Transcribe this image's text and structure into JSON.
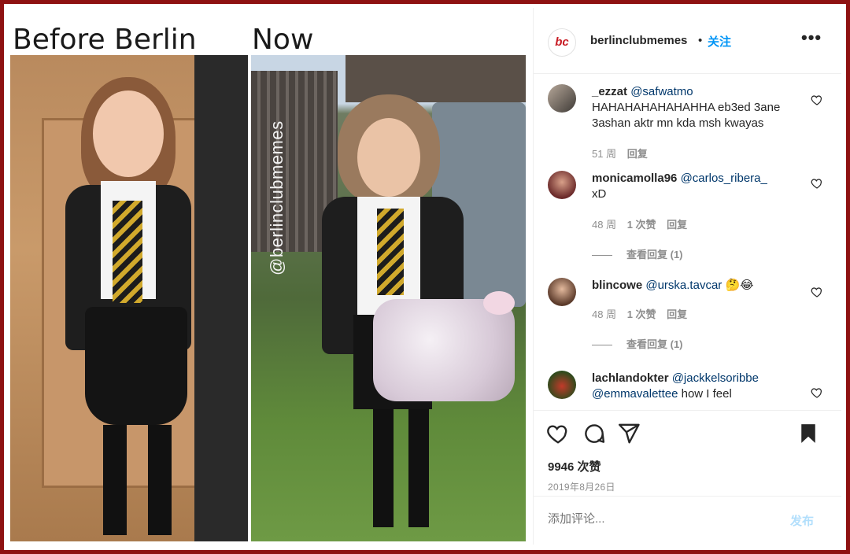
{
  "image": {
    "caption_before": "Before Berlin",
    "caption_now": "Now",
    "watermark": "@berlinclubmemes"
  },
  "header": {
    "avatar_text": "bc",
    "username": "berlinclubmemes",
    "separator": "•",
    "follow_label": "关注",
    "more_icon": "more-horizontal-icon"
  },
  "comments": [
    {
      "user": "_ezzat",
      "mention": "@safwatmo",
      "text": " HAHAHAHAHAHAHHA eb3ed 3ane 3ashan aktr mn kda msh kwayas",
      "time": "51 周",
      "likes": "",
      "reply": "回复",
      "view_replies": ""
    },
    {
      "user": "monicamolla96",
      "mention": "@carlos_ribera_",
      "text": " xD",
      "time": "48 周",
      "likes": "1 次赞",
      "reply": "回复",
      "view_replies": "查看回复 (1)"
    },
    {
      "user": "blincowe",
      "mention": "@urska.tavcar",
      "text": " 🤔😂",
      "time": "48 周",
      "likes": "1 次赞",
      "reply": "回复",
      "view_replies": "查看回复 (1)"
    },
    {
      "user": "lachlandokter",
      "mention": "@jackkelsoribbe",
      "mention2": "@emmavalettee",
      "text": " how I feel"
    }
  ],
  "actions": {
    "like_icon": "heart-icon",
    "comment_icon": "comment-icon",
    "share_icon": "share-icon",
    "save_icon": "bookmark-icon",
    "likes": "9946 次赞",
    "date": "2019年8月26日"
  },
  "add_comment": {
    "placeholder": "添加评论...",
    "post_label": "发布"
  },
  "colors": {
    "frame": "#8e1111",
    "accent": "#0095f6",
    "mention": "#00376b"
  }
}
